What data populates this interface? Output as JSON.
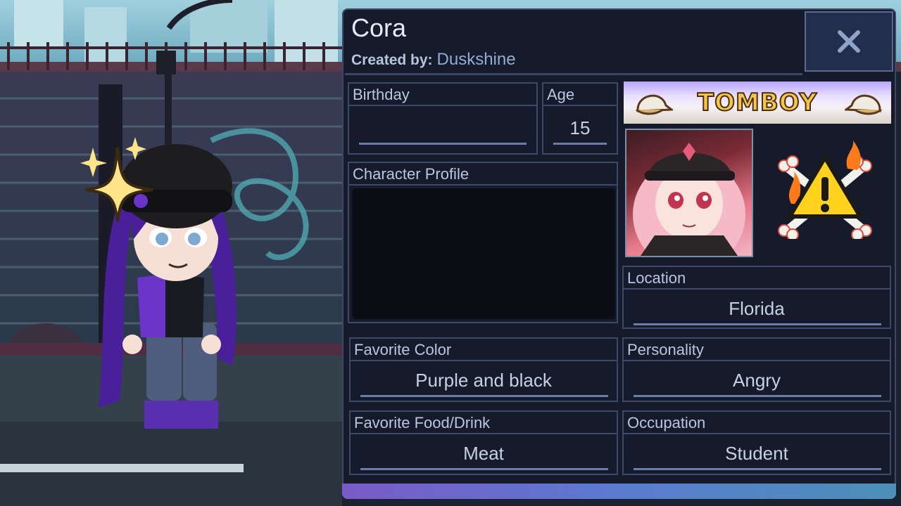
{
  "character": {
    "name": "Cora",
    "created_by_label": "Created by:",
    "creator": "Duskshine"
  },
  "close_button": {
    "label": "X"
  },
  "fields": {
    "birthday": {
      "label": "Birthday",
      "value": ""
    },
    "age": {
      "label": "Age",
      "value": "15"
    },
    "character_profile": {
      "label": "Character Profile",
      "value": ""
    },
    "favorite_color": {
      "label": "Favorite Color",
      "value": "Purple and black"
    },
    "favorite_food": {
      "label": "Favorite Food/Drink",
      "value": "Meat"
    },
    "location": {
      "label": "Location",
      "value": "Florida"
    },
    "personality": {
      "label": "Personality",
      "value": "Angry"
    },
    "occupation": {
      "label": "Occupation",
      "value": "Student"
    }
  },
  "banner": {
    "text": "TOMBOY"
  },
  "icons": {
    "close": "close-icon",
    "warning": "warning-icon",
    "portrait": "character-portrait",
    "sparkle": "sparkle-icon"
  },
  "colors": {
    "panel_bg": "#161b2c",
    "panel_border": "#3c4868",
    "label_text": "#b9c6e0",
    "value_text": "#c7d0e2",
    "accent_line": "#6a7da8",
    "banner_text": "#f6c64a",
    "hair": "#4a1f9a"
  }
}
